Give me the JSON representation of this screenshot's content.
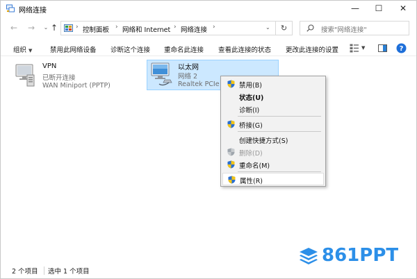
{
  "window": {
    "title": "网络连接",
    "minimize": "—",
    "maximize": "☐",
    "close": "✕"
  },
  "nav": {
    "back": "←",
    "forward": "→",
    "history": "⌄",
    "up": "↑",
    "breadcrumbs": [
      "控制面板",
      "网络和 Internet",
      "网络连接"
    ],
    "separator": "›",
    "dropdown": "⌄",
    "refresh": "↻",
    "search_placeholder": "搜索\"网络连接\""
  },
  "commands": {
    "organize": "组织",
    "organize_caret": "▼",
    "disable_device": "禁用此网络设备",
    "diagnose": "诊断这个连接",
    "rename": "重命名此连接",
    "view_status": "查看此连接的状态",
    "change_settings": "更改此连接的设置",
    "view_caret": "▼"
  },
  "connections": [
    {
      "name": "VPN",
      "status": "已断开连接",
      "device": "WAN Miniport (PPTP)",
      "selected": false
    },
    {
      "name": "以太网",
      "status": "网络 2",
      "device": "Realtek PCIe G",
      "selected": true
    }
  ],
  "context_menu": {
    "items": [
      {
        "label": "禁用(B)",
        "shield": true,
        "style": "normal"
      },
      {
        "label": "状态(U)",
        "shield": false,
        "style": "bold"
      },
      {
        "label": "诊断(I)",
        "shield": false,
        "style": "normal"
      },
      {
        "label": "桥接(G)",
        "shield": true,
        "style": "normal"
      },
      {
        "label": "创建快捷方式(S)",
        "shield": false,
        "style": "normal"
      },
      {
        "label": "删除(D)",
        "shield": true,
        "style": "disabled"
      },
      {
        "label": "重命名(M)",
        "shield": true,
        "style": "normal"
      },
      {
        "label": "属性(R)",
        "shield": true,
        "style": "hover"
      }
    ]
  },
  "statusbar": {
    "item_count": "2 个项目",
    "selected_count": "选中 1 个项目"
  },
  "watermark": {
    "text": "861PPT"
  },
  "colors": {
    "selection_bg": "#cce8ff",
    "selection_border": "#99d1ff",
    "menu_bg": "#f2f2f2",
    "watermark_blue": "#2c8fe8",
    "help_blue": "#1e6fd9"
  }
}
